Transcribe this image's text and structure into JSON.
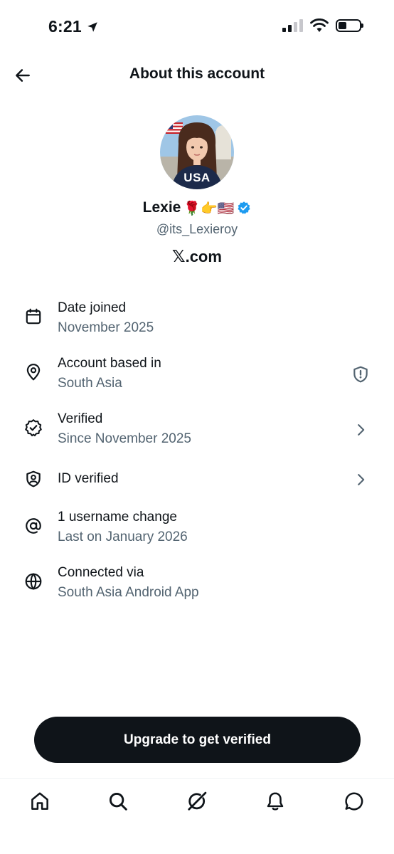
{
  "status_bar": {
    "time": "6:21"
  },
  "header": {
    "title": "About this account"
  },
  "profile": {
    "display_name": "Lexie",
    "name_emojis": "🌹👉🇺🇸",
    "handle": "@its_Lexieroy",
    "site_suffix": ".com",
    "site_glyph": "𝕏",
    "avatar_text": "USA"
  },
  "info": {
    "date_joined": {
      "title": "Date joined",
      "value": "November 2025"
    },
    "based_in": {
      "title": "Account based in",
      "value": "South Asia"
    },
    "verified": {
      "title": "Verified",
      "value": "Since November 2025"
    },
    "id_verified": {
      "title": "ID verified"
    },
    "username_change": {
      "title": "1 username change",
      "value": "Last on January 2026"
    },
    "connected_via": {
      "title": "Connected via",
      "value": "South Asia Android App"
    }
  },
  "upgrade_button": {
    "label": "Upgrade to get verified"
  },
  "colors": {
    "accent_blue": "#1d9bf0",
    "text_primary": "#0f1419",
    "text_secondary": "#536471"
  },
  "icons": [
    "back-arrow-icon",
    "calendar-icon",
    "location-pin-icon",
    "verified-check-icon",
    "shield-user-icon",
    "at-icon",
    "globe-icon",
    "shield-alert-icon",
    "chevron-right-icon",
    "home-icon",
    "search-icon",
    "grok-icon",
    "notifications-icon",
    "messages-icon"
  ]
}
